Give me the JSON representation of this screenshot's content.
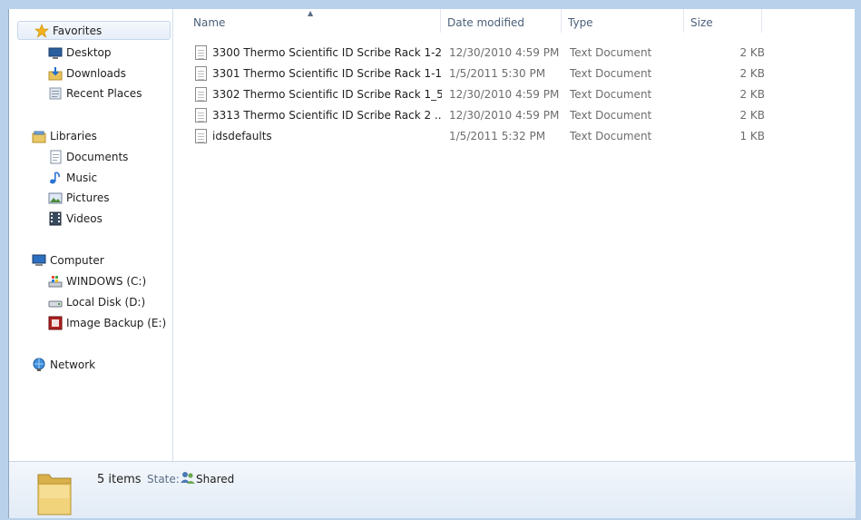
{
  "nav": {
    "favorites": "Favorites",
    "desktop": "Desktop",
    "downloads": "Downloads",
    "recent_places": "Recent Places",
    "libraries": "Libraries",
    "documents": "Documents",
    "music": "Music",
    "pictures": "Pictures",
    "videos": "Videos",
    "computer": "Computer",
    "drive_c": "WINDOWS (C:)",
    "drive_d": "Local Disk (D:)",
    "drive_e": "Image Backup (E:)",
    "network": "Network"
  },
  "columns": {
    "name": "Name",
    "date": "Date modified",
    "type": "Type",
    "size": "Size"
  },
  "files": [
    {
      "name": "3300 Thermo Scientific ID Scribe Rack 1-2...",
      "date": "12/30/2010 4:59 PM",
      "type": "Text Document",
      "size": "2 KB"
    },
    {
      "name": "3301 Thermo Scientific ID Scribe Rack 1-1...",
      "date": "1/5/2011 5:30 PM",
      "type": "Text Document",
      "size": "2 KB"
    },
    {
      "name": "3302 Thermo Scientific ID Scribe Rack 1_5...",
      "date": "12/30/2010 4:59 PM",
      "type": "Text Document",
      "size": "2 KB"
    },
    {
      "name": "3313 Thermo Scientific ID Scribe Rack 2 ...",
      "date": "12/30/2010 4:59 PM",
      "type": "Text Document",
      "size": "2 KB"
    },
    {
      "name": "idsdefaults",
      "date": "1/5/2011 5:32 PM",
      "type": "Text Document",
      "size": "1 KB"
    }
  ],
  "details": {
    "count": "5 items",
    "state_label": "State:",
    "state_value": "Shared"
  },
  "colors": {
    "accent": "#c6d6ea",
    "folder": "#e8c55a"
  }
}
